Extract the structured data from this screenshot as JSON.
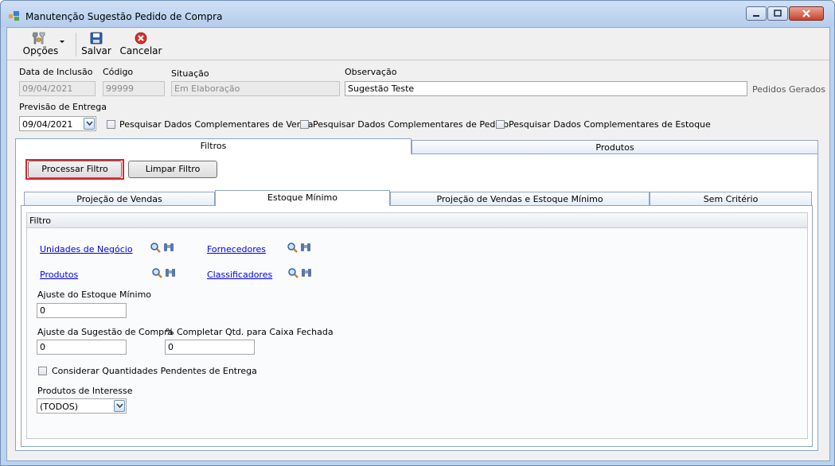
{
  "window": {
    "title": "Manutenção Sugestão Pedido de Compra"
  },
  "toolbar": {
    "options_label": "Opções",
    "save_label": "Salvar",
    "cancel_label": "Cancelar"
  },
  "header_fields": {
    "data_inclusao_label": "Data de Inclusão",
    "data_inclusao_value": "09/04/2021",
    "codigo_label": "Código",
    "codigo_value": "99999",
    "situacao_label": "Situação",
    "situacao_value": "Em Elaboração",
    "observacao_label": "Observação",
    "observacao_value": "Sugestão Teste",
    "pedidos_gerados_label": "Pedidos Gerados",
    "previsao_label": "Previsão de Entrega",
    "previsao_value": "09/04/2021"
  },
  "checkboxes": {
    "venda": "Pesquisar Dados Complementares de Venda",
    "pedido": "Pesquisar Dados Complementares de Pedido",
    "estoque": "Pesquisar Dados Complementares de Estoque"
  },
  "main_tabs": [
    {
      "label": "Filtros",
      "active": true
    },
    {
      "label": "Produtos",
      "active": false
    }
  ],
  "filter_buttons": {
    "process_label": "Processar Filtro",
    "clear_label": "Limpar Filtro"
  },
  "sub_tabs": [
    {
      "label": "Projeção de Vendas",
      "active": false
    },
    {
      "label": "Estoque Mínimo",
      "active": true
    },
    {
      "label": "Projeção de Vendas e Estoque Mínimo",
      "active": false
    },
    {
      "label": "Sem Critério",
      "active": false
    }
  ],
  "filtro": {
    "group_title": "Filtro",
    "unidades_link": "Unidades de Negócio",
    "fornecedores_link": "Fornecedores",
    "produtos_link": "Produtos",
    "classificadores_link": "Classificadores",
    "ajuste_estoque_label": "Ajuste do Estoque Mínimo",
    "ajuste_estoque_value": "0",
    "ajuste_sugestao_label": "Ajuste da Sugestão de Compra",
    "ajuste_sugestao_value": "0",
    "completar_label": "% Completar Qtd. para Caixa Fechada",
    "completar_value": "0",
    "considerar_label": "Considerar Quantidades Pendentes de Entrega",
    "produtos_interesse_label": "Produtos de Interesse",
    "produtos_interesse_value": "(TODOS)"
  },
  "colors": {
    "link": "#0000ee",
    "highlight_border": "#e0202a",
    "tab_border": "#8ea4c4",
    "title_bg": "#bcd3ee"
  }
}
